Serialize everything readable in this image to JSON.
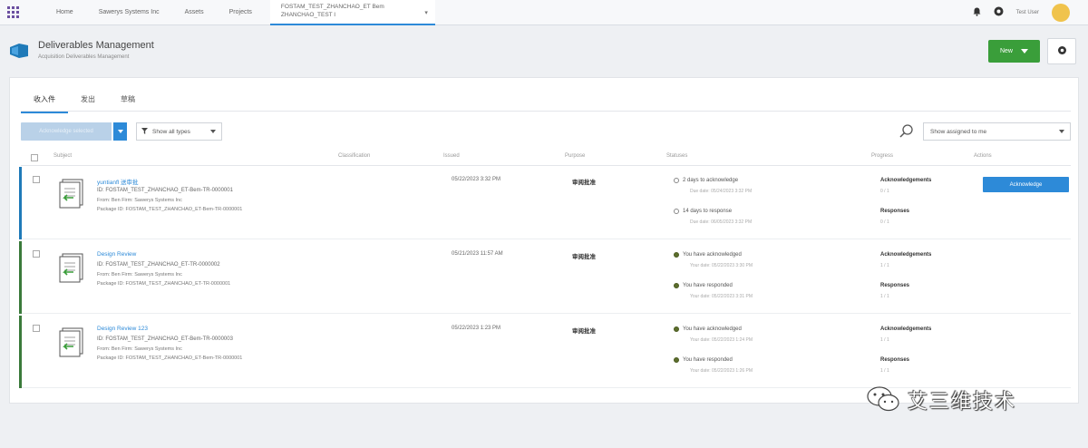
{
  "topnav": {
    "items": [
      "Home",
      "Sawerys Systems Inc",
      "Assets",
      "Projects"
    ],
    "active_tab_line1": "FOSTAM_TEST_ZHANCHAO_ET Bem",
    "active_tab_line2": "ZHANCHAO_TEST I",
    "user_name": "Test User"
  },
  "header": {
    "title": "Deliverables Management",
    "subtitle": "Acquisition Deliverables Management",
    "new_label": "New"
  },
  "tabs": [
    "收入件",
    "发出",
    "草稿"
  ],
  "filters": {
    "bulk_label": "Acknowledge selected",
    "type_label": "Show all types",
    "assign_label": "Show assigned to me"
  },
  "columns": {
    "subject": "Subject",
    "classification": "Classification",
    "issued": "Issued",
    "purpose": "Purpose",
    "statuses": "Statuses",
    "progress": "Progress",
    "actions": "Actions"
  },
  "rows": [
    {
      "title": "yuntianfl 送审批",
      "id": "ID: FOSTAM_TEST_ZHANCHAO_ET-Bem-TR-0000001",
      "from": "From: Ben Firm: Sawerys Systems Inc",
      "package": "Package ID: FOSTAM_TEST_ZHANCHAO_ET-Bem-TR-0000001",
      "issued": "05/22/2023 3:32 PM",
      "purpose": "审阅批准",
      "status1": "2 days to acknowledge",
      "status1_sub": "Due date: 05/24/2023 3:32 PM",
      "status2": "14 days to response",
      "status2_sub": "Due date: 06/05/2023 3:32 PM",
      "ack_label": "Acknowledgements",
      "ack_value": "0 / 1",
      "resp_label": "Responses",
      "resp_value": "0 / 1",
      "action": "Acknowledge",
      "accent": "#1f7ab8"
    },
    {
      "title": "Design Review",
      "id": "ID: FOSTAM_TEST_ZHANCHAO_ET-TR-0000002",
      "from": "From: Ben Firm: Sawerys Systems Inc",
      "package": "Package ID: FOSTAM_TEST_ZHANCHAO_ET-TR-0000001",
      "issued": "05/21/2023 11:57 AM",
      "purpose": "审阅批准",
      "status1": "You have acknowledged",
      "status1_sub": "Your date: 05/22/2023 3:30 PM",
      "status2": "You have responded",
      "status2_sub": "Your date: 05/22/2023 3:31 PM",
      "ack_label": "Acknowledgements",
      "ack_value": "1 / 1",
      "resp_label": "Responses",
      "resp_value": "1 / 1",
      "action": "",
      "accent": "#3a7a3a"
    },
    {
      "title": "Design Review 123",
      "id": "ID: FOSTAM_TEST_ZHANCHAO_ET-Bem-TR-0000003",
      "from": "From: Ben Firm: Sawerys Systems Inc",
      "package": "Package ID: FOSTAM_TEST_ZHANCHAO_ET-Bem-TR-0000001",
      "issued": "05/22/2023 1:23 PM",
      "purpose": "审阅批准",
      "status1": "You have acknowledged",
      "status1_sub": "Your date: 05/22/2023 1:24 PM",
      "status2": "You have responded",
      "status2_sub": "Your date: 05/22/2023 1:26 PM",
      "ack_label": "Acknowledgements",
      "ack_value": "1 / 1",
      "resp_label": "Responses",
      "resp_value": "1 / 1",
      "action": "",
      "accent": "#3a7a3a"
    }
  ],
  "watermark": {
    "text": "艾三维技术",
    "icon": "wechat-icon"
  },
  "colors": {
    "primary": "#2d8ad8",
    "new_button": "#3a9e3a",
    "avatar": "#f0c34c"
  }
}
